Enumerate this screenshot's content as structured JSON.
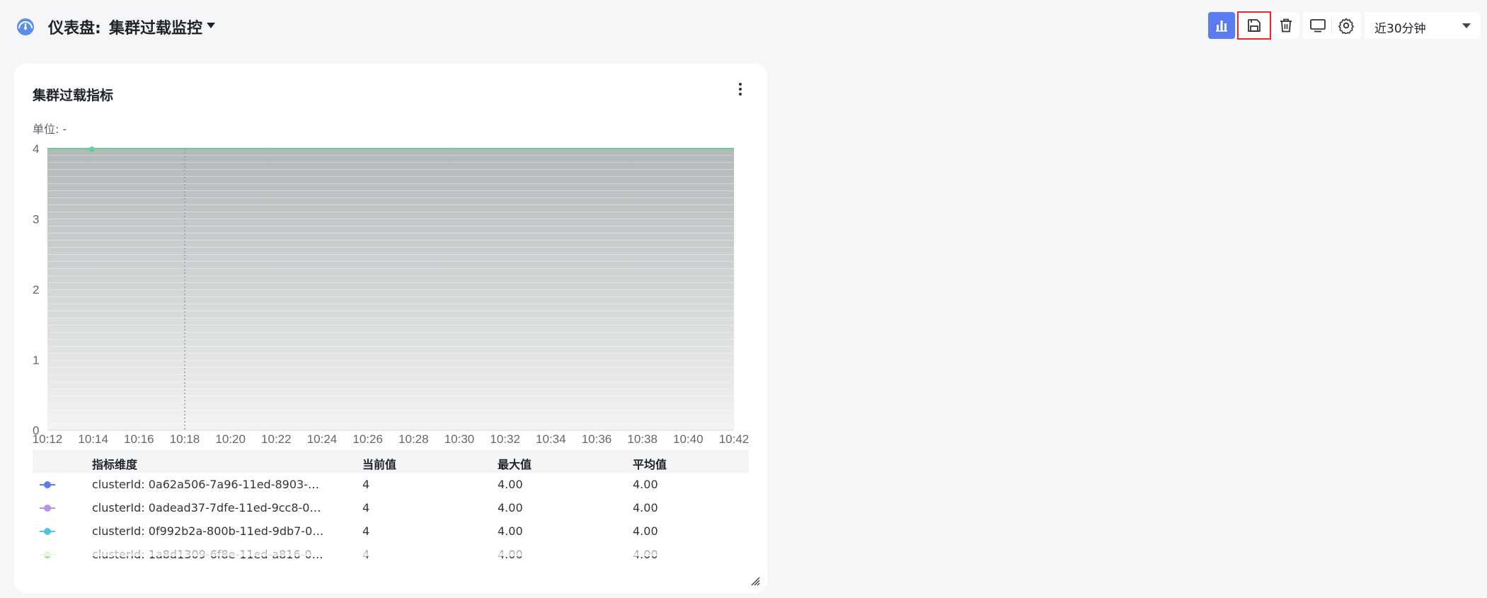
{
  "header": {
    "title_prefix": "仪表盘:",
    "title_name": "集群过载监控",
    "dashboard_icon": "dashboard-gauge-icon",
    "toolbar": {
      "chart_icon": "bar-chart-icon",
      "save_icon": "save-icon",
      "delete_icon": "trash-icon",
      "monitor_icon": "monitor-icon",
      "settings_icon": "gear-icon"
    },
    "time_range": "近30分钟"
  },
  "panel": {
    "title": "集群过载指标",
    "unit_label": "单位: -",
    "more_icon": "more-vertical-icon",
    "resize_icon": "resize-handle-icon"
  },
  "chart_data": {
    "type": "area",
    "y_ticks": [
      "0",
      "1",
      "2",
      "3",
      "4"
    ],
    "x_ticks": [
      "10:12",
      "10:14",
      "10:16",
      "10:18",
      "10:20",
      "10:22",
      "10:24",
      "10:26",
      "10:28",
      "10:30",
      "10:32",
      "10:34",
      "10:36",
      "10:38",
      "10:40",
      "10:42"
    ],
    "ylim": [
      0,
      4
    ],
    "series_value": 4,
    "hover_time": "10:18",
    "colors": {
      "line": "#5fd39a",
      "area_top": "#b3b8b9",
      "area_bottom": "#f2f3f4"
    }
  },
  "legend": {
    "headers": {
      "dimension": "指标维度",
      "current": "当前值",
      "max": "最大值",
      "avg": "平均值"
    },
    "rows": [
      {
        "color": "#5b7cf0",
        "dimension": "clusterId: 0a62a506-7a96-11ed-8903-025…",
        "current": "4",
        "max": "4.00",
        "avg": "4.00"
      },
      {
        "color": "#b98ff2",
        "dimension": "clusterId: 0adead37-7dfe-11ed-9cc8-0255…",
        "current": "4",
        "max": "4.00",
        "avg": "4.00"
      },
      {
        "color": "#4cc6de",
        "dimension": "clusterId: 0f992b2a-800b-11ed-9db7-0255…",
        "current": "4",
        "max": "4.00",
        "avg": "4.00"
      },
      {
        "color": "#a6dc8c",
        "dimension": "clusterId: 1a8d1309-6f8e-11ed-a816-0255…",
        "current": "4",
        "max": "4.00",
        "avg": "4.00"
      }
    ]
  }
}
